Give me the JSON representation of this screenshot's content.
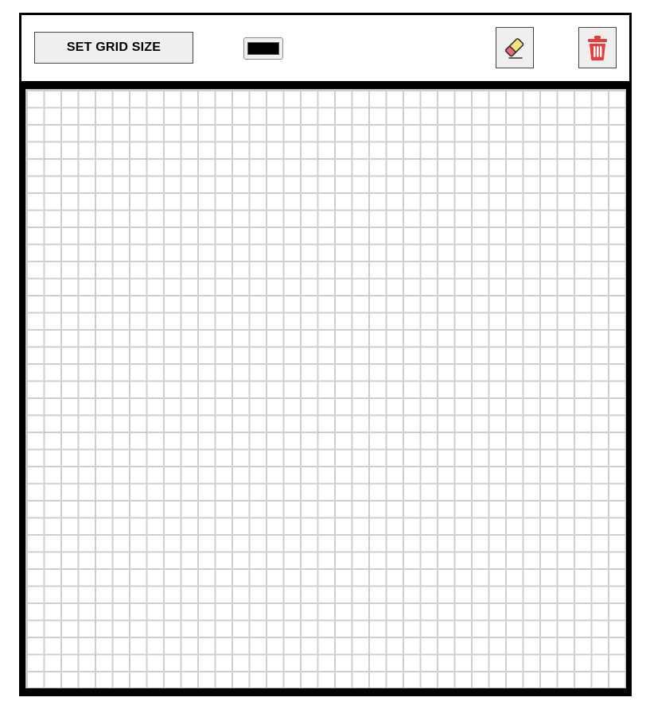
{
  "toolbar": {
    "set_grid_size_label": "SET GRID SIZE",
    "color_picker": {
      "value": "#000000"
    },
    "eraser_button": {
      "icon": "eraser-icon"
    },
    "clear_button": {
      "icon": "trash-icon",
      "color": "#ee3a3a"
    }
  },
  "grid": {
    "columns": 35,
    "rows": 35,
    "line_color": "#cfcfcf",
    "background": "#ffffff"
  },
  "colors": {
    "frame": "#000000",
    "toolbar_bg": "#ffffff",
    "button_bg": "#efefef"
  }
}
